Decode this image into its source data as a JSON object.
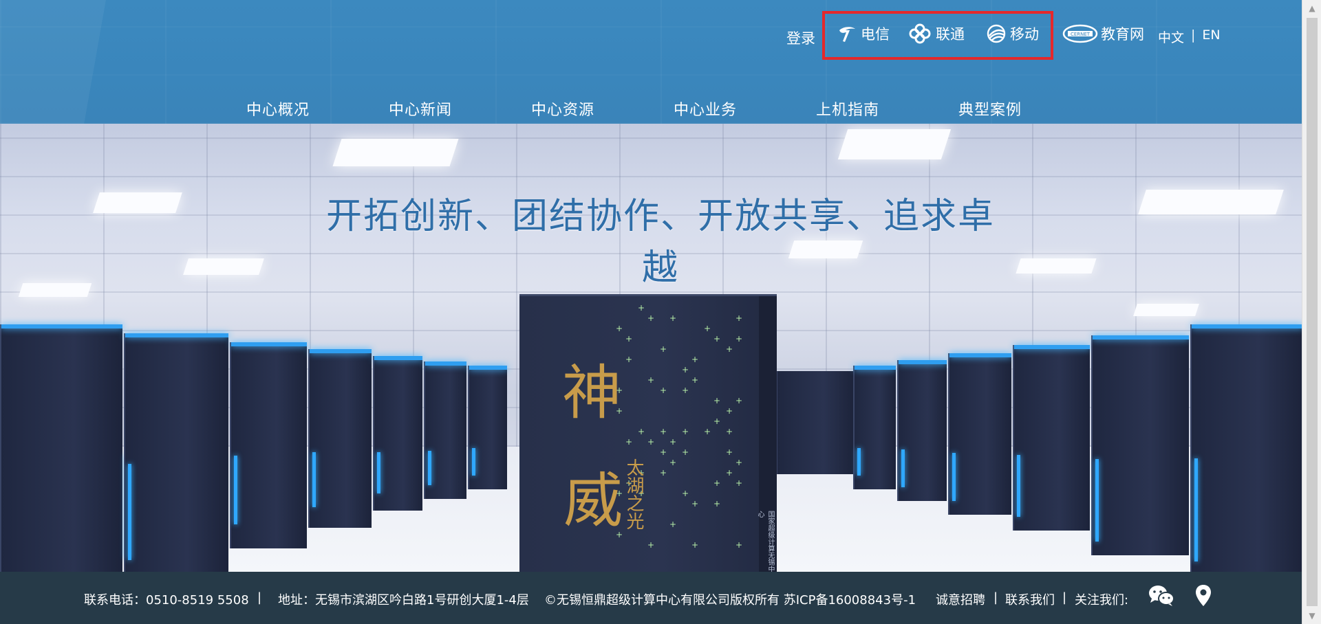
{
  "header": {
    "login": "登录",
    "isp": [
      {
        "label": "电信",
        "icon": "china-telecom-logo-icon"
      },
      {
        "label": "联通",
        "icon": "china-unicom-logo-icon"
      },
      {
        "label": "移动",
        "icon": "china-mobile-logo-icon"
      }
    ],
    "cernet": {
      "label": "教育网",
      "icon": "cernet-logo-icon"
    },
    "lang": {
      "zh": "中文",
      "sep": "|",
      "en": "EN"
    }
  },
  "nav": [
    "中心概况",
    "中心新闻",
    "中心资源",
    "中心业务",
    "上机指南",
    "典型案例"
  ],
  "hero": {
    "slogan": "开拓创新、团结协作、开放共享、追求卓越",
    "cabinet_title_1": "神",
    "cabinet_title_2": "威",
    "cabinet_subtitle": "太湖之光",
    "cabinet_vertical": "国家超级计算无锡中心"
  },
  "footer": {
    "phone": "联系电话：0510-8519 5508",
    "sep1": "|",
    "address": "地址：无锡市滨湖区吟白路1号研创大厦1-4层",
    "copyright": "©无锡恒鼎超级计算中心有限公司版权所有 苏ICP备16008843号-1",
    "recruit": "诚意招聘",
    "sep2": "|",
    "contact": "联系我们",
    "sep3": "|",
    "follow": "关注我们:",
    "icons": [
      "wechat-icon",
      "location-pin-icon"
    ]
  },
  "colors": {
    "header_bg": "#3a86bc",
    "highlight_border": "#e5282b",
    "slogan": "#2f6ea8",
    "footer_bg": "#263a48",
    "cabinet_gold": "#c89c4a"
  }
}
